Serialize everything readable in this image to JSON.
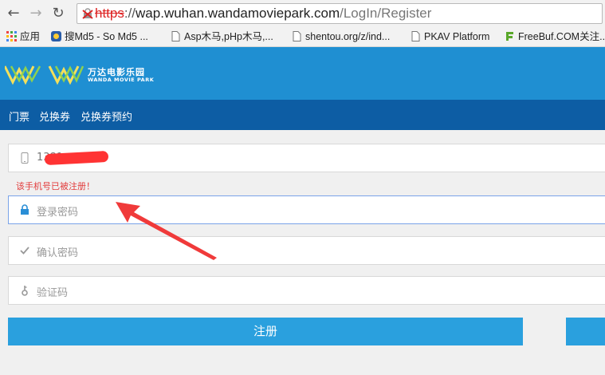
{
  "browser": {
    "url_scheme": "https",
    "url_sep": "://",
    "url_host": "wap.wuhan.wandamovieparkcom",
    "url_host_display": "wap.wuhan.wandamoviepark.com",
    "url_path": "/LogIn/Register",
    "bookmarks": [
      {
        "label": "应用",
        "icon": "apps-grid-icon"
      },
      {
        "label": "搜Md5 - So Md5 ...",
        "icon": "md5-site-icon"
      },
      {
        "label": "Asp木马,pHp木马,...",
        "icon": "page-icon"
      },
      {
        "label": "shentou.org/z/ind...",
        "icon": "page-icon"
      },
      {
        "label": "PKAV Platform",
        "icon": "page-icon"
      },
      {
        "label": "FreeBuf.COM关注...",
        "icon": "freebuf-icon"
      }
    ]
  },
  "header": {
    "title": "万达电影乐园",
    "subtitle": "WANDA MOVIE PARK"
  },
  "menu": {
    "items": [
      "门票",
      "兑换券",
      "兑换券预约"
    ]
  },
  "form": {
    "phone_value": "1381",
    "phone_suffix": "7",
    "phone_error": "该手机号已被注册！",
    "password_placeholder": "登录密码",
    "confirm_placeholder": "确认密码",
    "captcha_placeholder": "验证码",
    "register_label": "注册"
  },
  "colors": {
    "header_bg": "#1f8fd2",
    "menu_bg": "#0d5da4",
    "button_bg": "#2aa0de",
    "error": "#e23c3c",
    "annotation_arrow": "#f03a3a"
  }
}
